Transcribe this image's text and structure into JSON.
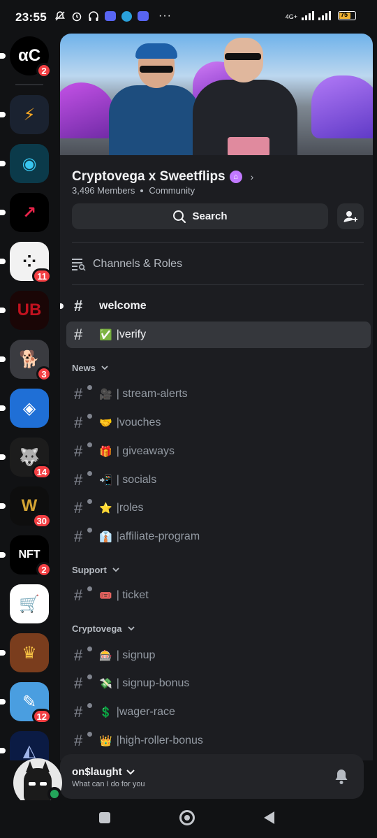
{
  "status_bar": {
    "time": "23:55",
    "network": "4G+",
    "battery_level": "75",
    "battery_fraction": 0.75,
    "more": "···"
  },
  "rail": {
    "servers": [
      {
        "name": "dc-server",
        "glyph": "αC",
        "bg": "#000000",
        "fg": "#ffffff",
        "badge": "2",
        "pill": true
      },
      {
        "name": "lightning-server",
        "glyph": "⚡",
        "bg": "#1a2230",
        "fg": "#f5a623",
        "badge": "",
        "pill": true
      },
      {
        "name": "discord-cyber-server",
        "glyph": "◉",
        "bg": "#0b3a4a",
        "fg": "#39c6f0",
        "badge": "",
        "pill": true
      },
      {
        "name": "chart-server",
        "glyph": "↗",
        "bg": "#000000",
        "fg": "#e8244a",
        "badge": "",
        "pill": true
      },
      {
        "name": "dots-server",
        "glyph": "⁘",
        "bg": "#f2f2f2",
        "fg": "#111111",
        "badge": "11",
        "pill": true
      },
      {
        "name": "undead-blocks-server",
        "glyph": "UB",
        "bg": "#1a0606",
        "fg": "#c1121f",
        "badge": "",
        "pill": true
      },
      {
        "name": "shiba-server",
        "glyph": "🐕",
        "bg": "#3a3b40",
        "fg": "#f0a24b",
        "badge": "3",
        "pill": true
      },
      {
        "name": "figma-server",
        "glyph": "◈",
        "bg": "#1f6fd6",
        "fg": "#ffffff",
        "badge": "",
        "pill": true
      },
      {
        "name": "wolf-chart-server",
        "glyph": "🐺",
        "bg": "#1c1c1c",
        "fg": "#cccccc",
        "badge": "14",
        "pill": true
      },
      {
        "name": "wolves-server",
        "glyph": "W",
        "bg": "#0e0e0e",
        "fg": "#d4a434",
        "badge": "30",
        "pill": true
      },
      {
        "name": "nft-server",
        "glyph": "NFT",
        "bg": "#000000",
        "fg": "#ffffff",
        "badge": "2",
        "pill": true
      },
      {
        "name": "cart-server",
        "glyph": "🛒",
        "bg": "#ffffff",
        "fg": "#f4b400",
        "badge": "",
        "pill": false
      },
      {
        "name": "king-server",
        "glyph": "♛",
        "bg": "#7a3d1d",
        "fg": "#f6c244",
        "badge": "",
        "pill": true
      },
      {
        "name": "pen-server",
        "glyph": "✎",
        "bg": "#4a9ee0",
        "fg": "#ffffff",
        "badge": "12",
        "pill": true
      },
      {
        "name": "fox-server",
        "glyph": "◭",
        "bg": "#0b1b44",
        "fg": "#9fb4e8",
        "badge": "",
        "pill": true
      }
    ]
  },
  "server": {
    "name": "Cryptovega x Sweetflips",
    "members": "3,496 Members",
    "type": "Community",
    "search_label": "Search",
    "channels_roles_label": "Channels & Roles"
  },
  "channels": {
    "top": [
      {
        "name": "welcome",
        "emoji": "",
        "prefix": "",
        "state": "unread",
        "locked": false
      },
      {
        "name": "verify",
        "emoji": "✅",
        "prefix": "|",
        "state": "selected",
        "locked": false
      }
    ],
    "categories": [
      {
        "name": "News",
        "channels": [
          {
            "emoji": "🎥",
            "text": "| stream-alerts"
          },
          {
            "emoji": "🤝",
            "text": "|vouches"
          },
          {
            "emoji": "🎁",
            "text": "| giveaways"
          },
          {
            "emoji": "📲",
            "text": "| socials"
          },
          {
            "emoji": "⭐",
            "text": "|roles"
          },
          {
            "emoji": "👔",
            "text": "|affiliate-program"
          }
        ]
      },
      {
        "name": "Support",
        "channels": [
          {
            "emoji": "🎟️",
            "text": "| ticket"
          }
        ]
      },
      {
        "name": "Cryptovega",
        "channels": [
          {
            "emoji": "🎰",
            "text": "| signup"
          },
          {
            "emoji": "💸",
            "text": "| signup-bonus"
          },
          {
            "emoji": "💲",
            "text": "|wager-race"
          },
          {
            "emoji": "👑",
            "text": "|high-roller-bonus"
          }
        ]
      }
    ]
  },
  "user": {
    "name": "on$laught",
    "status_text": "What can I do for you"
  },
  "colors": {
    "background": "#111214",
    "panel": "#1c1d21",
    "selected": "#35373c",
    "badge": "#f23f43",
    "online": "#23a55a"
  }
}
